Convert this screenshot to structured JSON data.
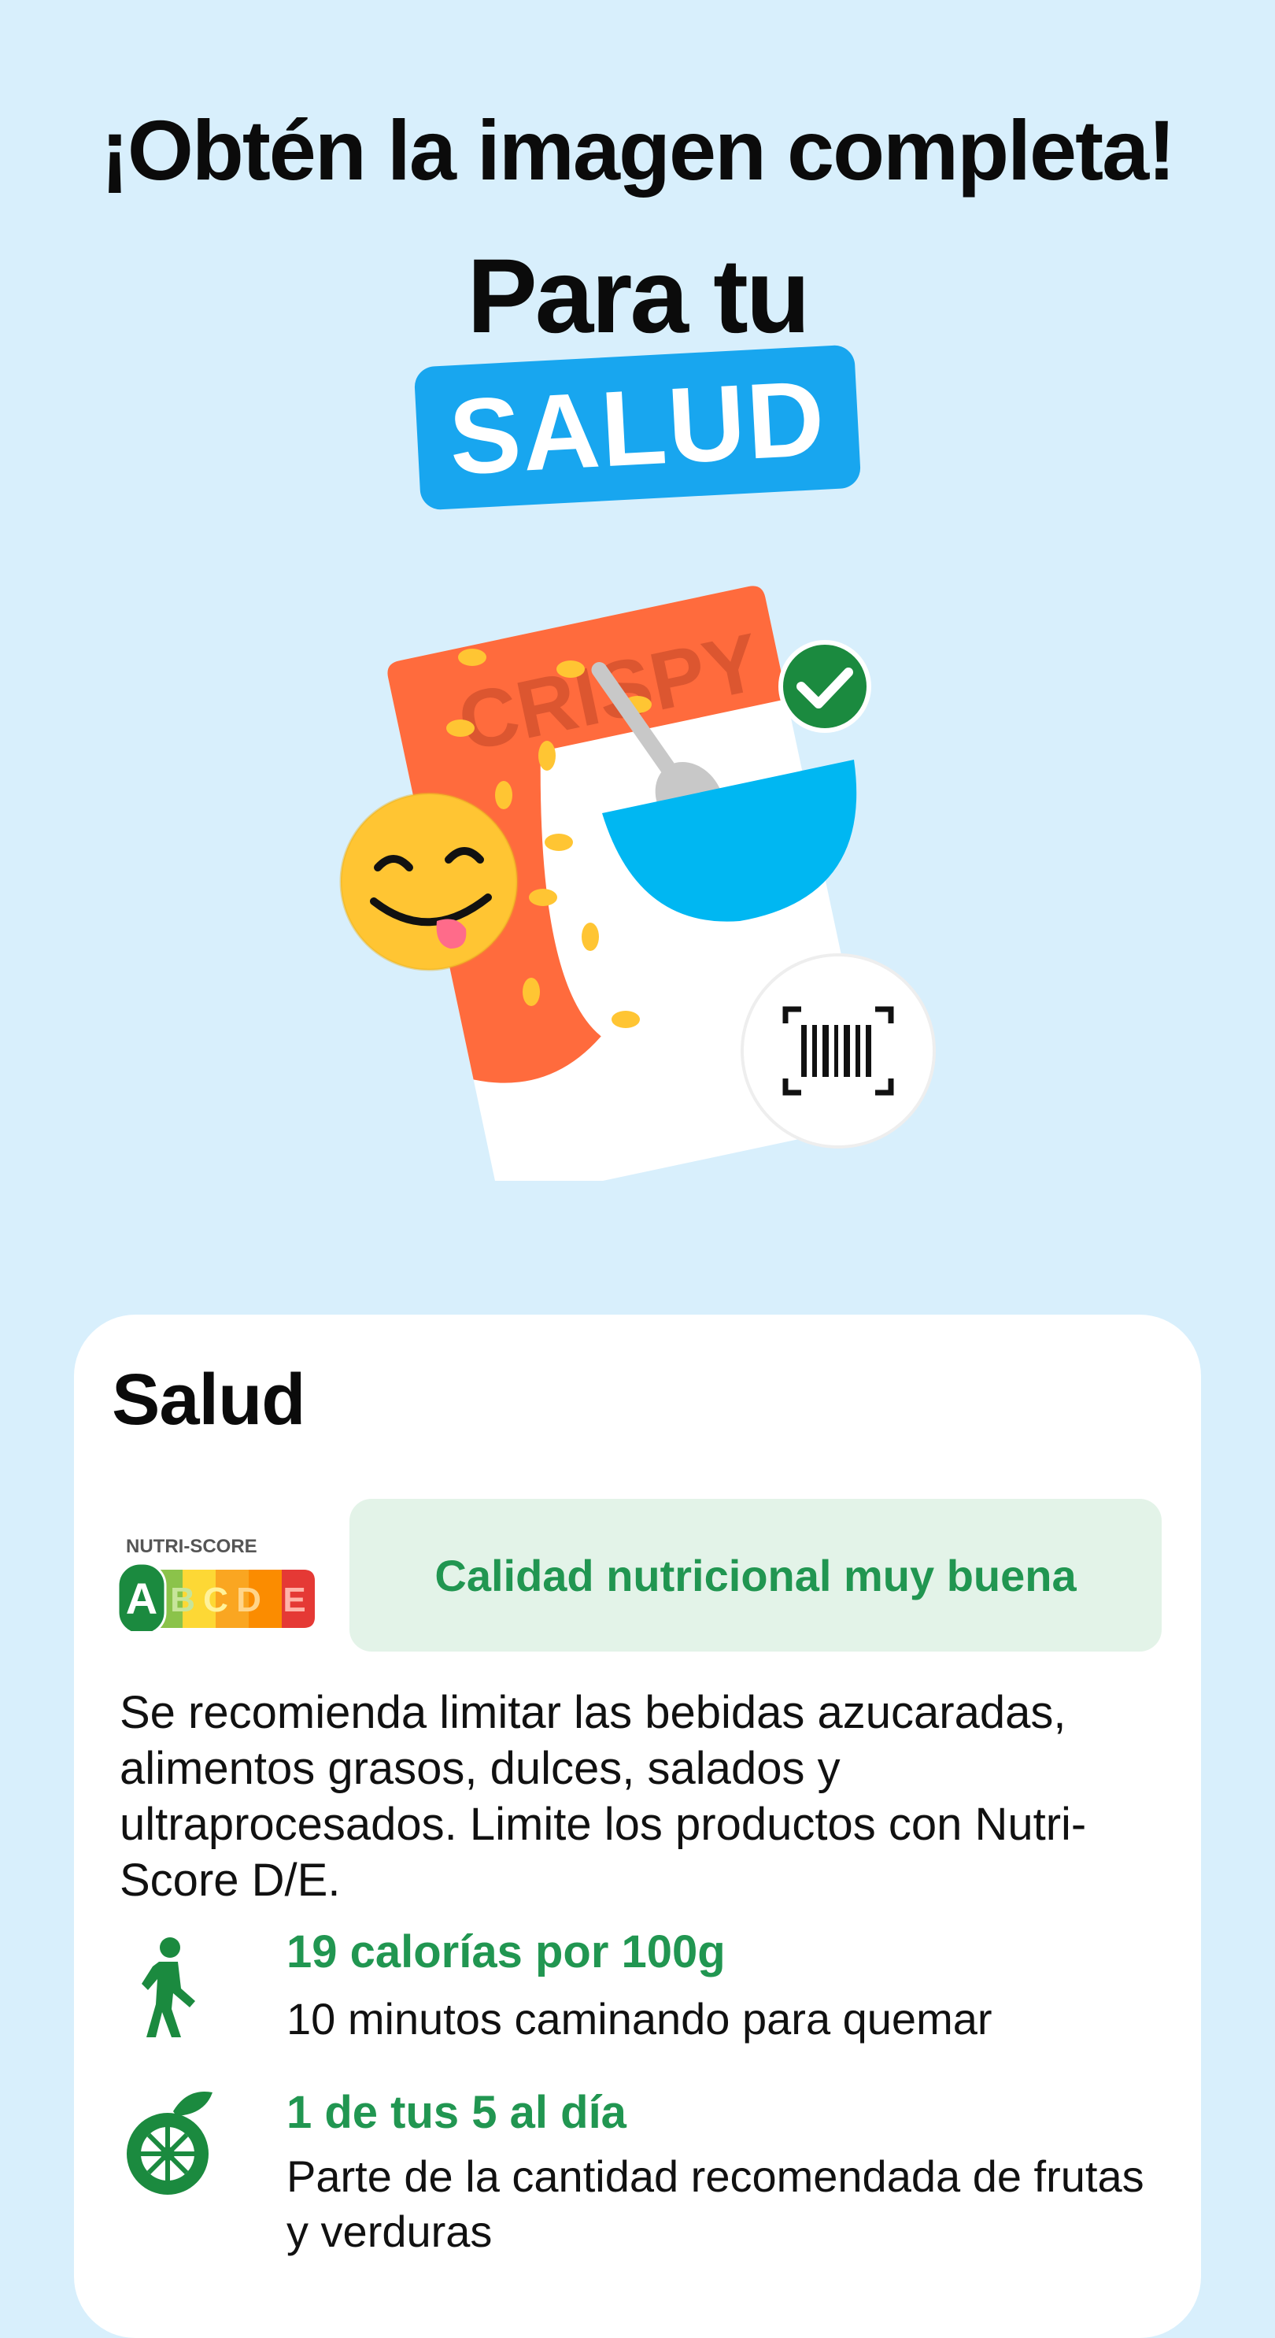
{
  "header": {
    "headline": "¡Obtén la imagen completa!",
    "subhead": "Para tu",
    "badge": "SALUD"
  },
  "illustration": {
    "package_text": "CRISPY",
    "icons": [
      "cereal-box-icon",
      "smiley-tongue-icon",
      "check-circle-icon",
      "barcode-scan-icon"
    ]
  },
  "card": {
    "title": "Salud",
    "nutri_score": {
      "label": "NUTRI-SCORE",
      "grades": [
        "A",
        "B",
        "C",
        "D",
        "E"
      ],
      "selected": "A",
      "colors": [
        "#1b8a3f",
        "#8bc34a",
        "#fdd835",
        "#fb8c00",
        "#e53935"
      ]
    },
    "nutri_quality": "Calidad nutricional muy buena",
    "advice": "Se recomienda limitar las bebidas azucaradas, alimentos grasos, dulces, salados y ultraprocesados. Limite los productos con Nutri-Score D/E.",
    "items": [
      {
        "icon": "walking-person-icon",
        "title": "19 calorías por 100g",
        "text": "10 minutos caminando para quemar"
      },
      {
        "icon": "orange-fruit-icon",
        "title": "1 de tus 5 al día",
        "text": "Parte de la cantidad recomendada de frutas y verduras"
      }
    ]
  },
  "colors": {
    "background": "#d8effc",
    "accent_blue": "#18a6ef",
    "green": "#219651",
    "green_light": "#e3f3e8"
  }
}
